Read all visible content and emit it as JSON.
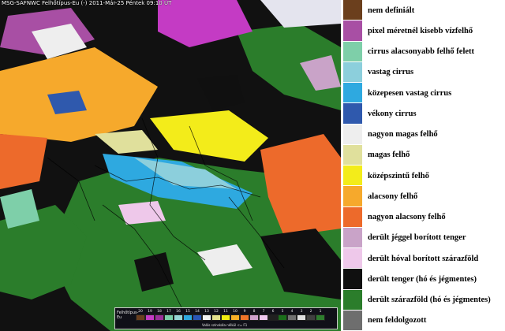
{
  "map": {
    "header": "MSG-SAFNWC Felhőtípus-Eu (-) 2011-Már-25 Péntek 09:10 UT"
  },
  "scale_bar": {
    "title": "Felhőtípus-Eu",
    "numbers": [
      "20",
      "19",
      "18",
      "17",
      "16",
      "15",
      "14",
      "13",
      "12",
      "11",
      "10",
      "9",
      "8",
      "7",
      "6",
      "5",
      "4",
      "3",
      "2",
      "1"
    ],
    "colors": [
      "#6a3f1e",
      "#c43bc4",
      "#9a2f9a",
      "#7acfa8",
      "#98d6d6",
      "#2fa9e0",
      "#2a56b8",
      "#f2f2f2",
      "#e4e08c",
      "#f2ec10",
      "#f8ae26",
      "#f07428",
      "#d0a0cc",
      "#f0c8f0",
      "#202020",
      "#1a6e1a",
      "#707070",
      "#e0e0e0",
      "#404040",
      "#2e7d2e"
    ],
    "note": "Valós színskála nélkül <= F1"
  },
  "legend": {
    "items": [
      {
        "label": "nem definiált",
        "color": "#6b3f1d"
      },
      {
        "label": "pixel méretnél kisebb vízfelhő",
        "color": "#a84fa4"
      },
      {
        "label": "cirrus alacsonyabb felhő felett",
        "color": "#7ecfa9"
      },
      {
        "label": "vastag cirrus",
        "color": "#8ccfdc"
      },
      {
        "label": "közepesen vastag cirrus",
        "color": "#2ea9e0"
      },
      {
        "label": "vékony cirrus",
        "color": "#2f59ad"
      },
      {
        "label": "nagyon magas felhő",
        "color": "#eeeeee"
      },
      {
        "label": "magas  felhő",
        "color": "#e0e09c"
      },
      {
        "label": "középszintű felhő",
        "color": "#f3ec1a"
      },
      {
        "label": "alacsony felhő",
        "color": "#f6a92c"
      },
      {
        "label": "nagyon alacsony felhő",
        "color": "#ed6a2b"
      },
      {
        "label": "derült jéggel borított tenger",
        "color": "#c9a3c8"
      },
      {
        "label": "derült hóval borított szárazföld",
        "color": "#eec8ea"
      },
      {
        "label": "derült tenger (hó és jégmentes)",
        "color": "#101010"
      },
      {
        "label": "derült szárazföld (hó és jégmentes)",
        "color": "#2b7d2b"
      },
      {
        "label": "nem feldolgozott",
        "color": "#6e6e6e"
      }
    ]
  }
}
